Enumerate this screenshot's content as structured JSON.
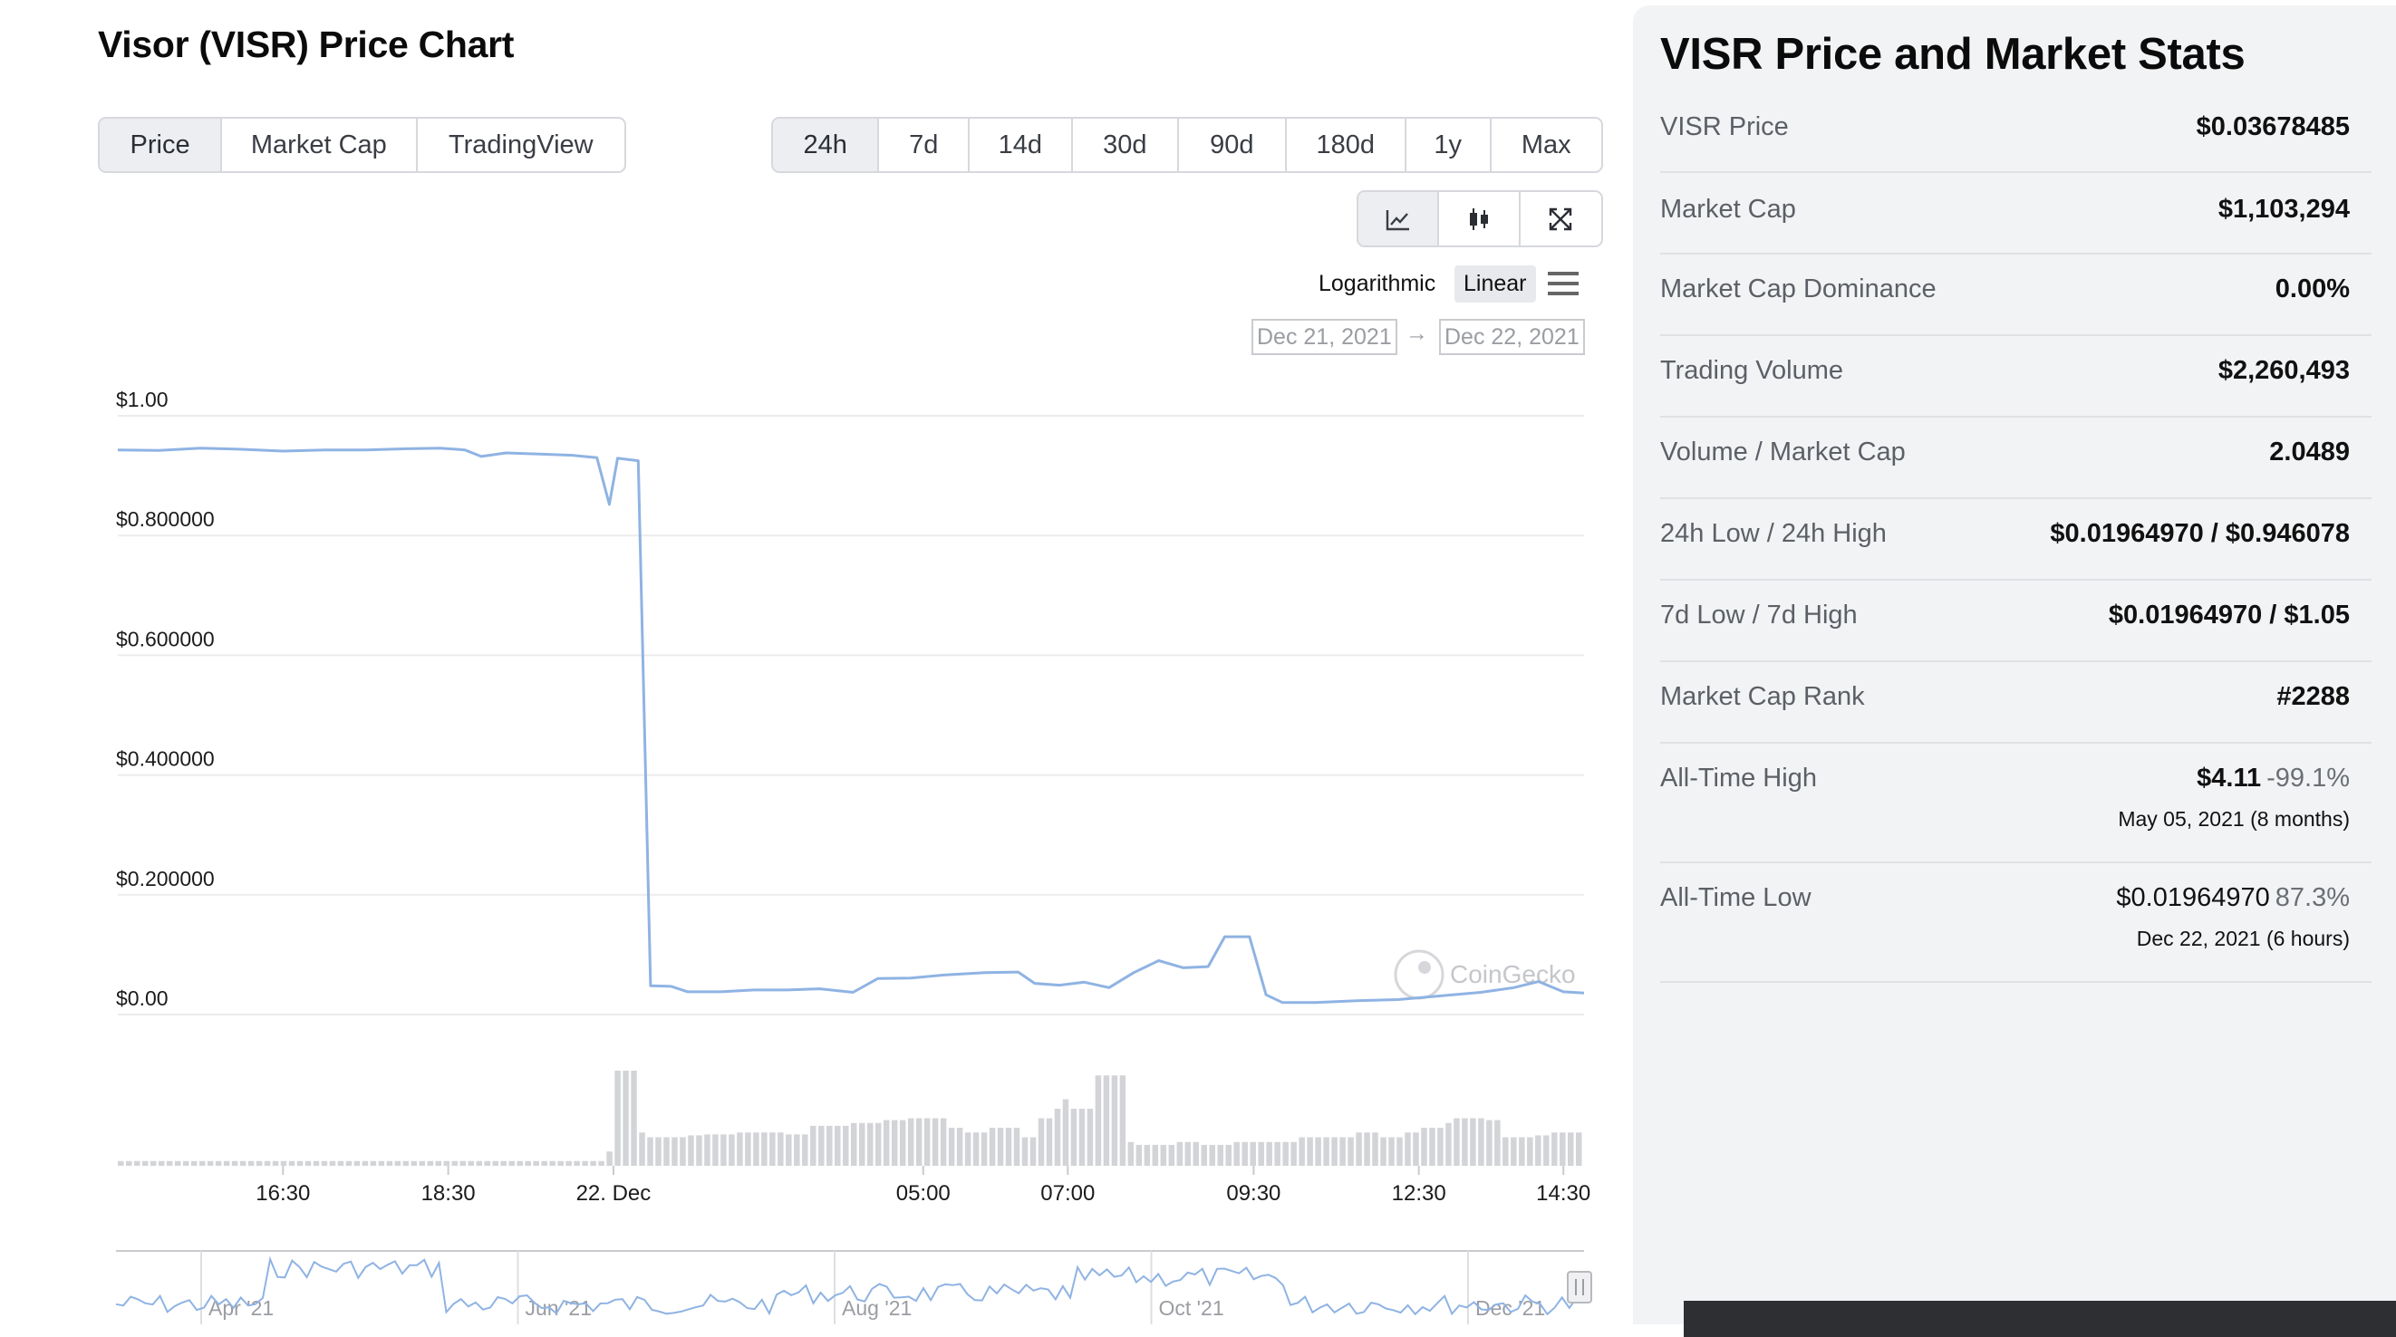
{
  "page_title": "Visor (VISR) Price Chart",
  "tabs": [
    {
      "label": "Price",
      "active": true
    },
    {
      "label": "Market Cap",
      "active": false
    },
    {
      "label": "TradingView",
      "active": false
    }
  ],
  "ranges": [
    {
      "label": "24h",
      "active": true
    },
    {
      "label": "7d",
      "active": false
    },
    {
      "label": "14d",
      "active": false
    },
    {
      "label": "30d",
      "active": false
    },
    {
      "label": "90d",
      "active": false
    },
    {
      "label": "180d",
      "active": false
    },
    {
      "label": "1y",
      "active": false
    },
    {
      "label": "Max",
      "active": false
    }
  ],
  "chart_type_icons": [
    "line-chart-icon",
    "candlestick-icon",
    "fullscreen-icon"
  ],
  "scale": {
    "log_label": "Logarithmic",
    "linear_label": "Linear",
    "active": "Linear"
  },
  "date_range": {
    "from": "Dec 21, 2021",
    "to": "Dec 22, 2021"
  },
  "watermark": "CoinGecko",
  "colors": {
    "line": "#8fb3e3",
    "volume": "#d3d4d7",
    "grid": "#ececee",
    "navigator_line": "#8fb3e3"
  },
  "chart_data": {
    "type": "line",
    "y_ticks": [
      "$1.00",
      "$0.800000",
      "$0.600000",
      "$0.400000",
      "$0.200000",
      "$0.00"
    ],
    "ylim": [
      0,
      1.0
    ],
    "x_ticks": [
      {
        "label": "16:30",
        "t": 2.5
      },
      {
        "label": "18:30",
        "t": 4.5
      },
      {
        "label": "22. Dec",
        "t": 6.5
      },
      {
        "label": "05:00",
        "t": 10.25
      },
      {
        "label": "07:00",
        "t": 12.0
      },
      {
        "label": "09:30",
        "t": 14.25
      },
      {
        "label": "12:30",
        "t": 16.25
      },
      {
        "label": "14:30",
        "t": 18.0
      }
    ],
    "xlim": [
      0.5,
      18.25
    ],
    "series": [
      {
        "values": [
          [
            0.5,
            0.943
          ],
          [
            1.0,
            0.942
          ],
          [
            1.5,
            0.946
          ],
          [
            2.0,
            0.944
          ],
          [
            2.5,
            0.941
          ],
          [
            3.0,
            0.943
          ],
          [
            3.5,
            0.943
          ],
          [
            4.0,
            0.945
          ],
          [
            4.4,
            0.946
          ],
          [
            4.7,
            0.943
          ],
          [
            4.9,
            0.932
          ],
          [
            5.2,
            0.938
          ],
          [
            5.6,
            0.936
          ],
          [
            6.0,
            0.934
          ],
          [
            6.3,
            0.93
          ],
          [
            6.45,
            0.852
          ],
          [
            6.55,
            0.929
          ],
          [
            6.8,
            0.925
          ],
          [
            6.95,
            0.048
          ],
          [
            7.2,
            0.047
          ],
          [
            7.4,
            0.038
          ],
          [
            7.8,
            0.038
          ],
          [
            8.2,
            0.041
          ],
          [
            8.6,
            0.041
          ],
          [
            9.0,
            0.043
          ],
          [
            9.4,
            0.037
          ],
          [
            9.7,
            0.06
          ],
          [
            10.1,
            0.061
          ],
          [
            10.5,
            0.066
          ],
          [
            11.0,
            0.07
          ],
          [
            11.4,
            0.071
          ],
          [
            11.6,
            0.052
          ],
          [
            11.9,
            0.049
          ],
          [
            12.2,
            0.054
          ],
          [
            12.5,
            0.045
          ],
          [
            12.8,
            0.07
          ],
          [
            13.1,
            0.09
          ],
          [
            13.4,
            0.078
          ],
          [
            13.7,
            0.08
          ],
          [
            13.9,
            0.13
          ],
          [
            14.2,
            0.13
          ],
          [
            14.4,
            0.033
          ],
          [
            14.6,
            0.02
          ],
          [
            15.0,
            0.02
          ],
          [
            15.5,
            0.023
          ],
          [
            16.0,
            0.025
          ],
          [
            16.5,
            0.031
          ],
          [
            17.0,
            0.037
          ],
          [
            17.4,
            0.045
          ],
          [
            17.7,
            0.055
          ],
          [
            18.0,
            0.038
          ],
          [
            18.25,
            0.036
          ]
        ]
      }
    ],
    "volume": [
      0.05,
      0.05,
      0.05,
      0.05,
      0.05,
      0.05,
      0.05,
      0.05,
      0.05,
      0.05,
      0.05,
      0.05,
      0.05,
      0.05,
      0.05,
      0.05,
      0.05,
      0.05,
      0.05,
      0.05,
      0.05,
      0.05,
      0.05,
      0.05,
      0.05,
      0.05,
      0.05,
      0.05,
      0.05,
      0.05,
      0.05,
      0.05,
      0.05,
      0.05,
      0.05,
      0.05,
      0.05,
      0.05,
      0.05,
      0.05,
      0.05,
      0.05,
      0.05,
      0.05,
      0.05,
      0.05,
      0.05,
      0.05,
      0.05,
      0.05,
      0.05,
      0.05,
      0.05,
      0.05,
      0.05,
      0.05,
      0.05,
      0.05,
      0.05,
      0.05,
      0.15,
      1.0,
      1.0,
      1.0,
      0.35,
      0.3,
      0.3,
      0.3,
      0.3,
      0.3,
      0.32,
      0.32,
      0.33,
      0.33,
      0.33,
      0.33,
      0.35,
      0.35,
      0.35,
      0.35,
      0.35,
      0.35,
      0.33,
      0.33,
      0.33,
      0.42,
      0.42,
      0.42,
      0.42,
      0.42,
      0.45,
      0.45,
      0.45,
      0.45,
      0.48,
      0.48,
      0.48,
      0.5,
      0.5,
      0.5,
      0.5,
      0.5,
      0.4,
      0.4,
      0.35,
      0.35,
      0.35,
      0.4,
      0.4,
      0.4,
      0.4,
      0.3,
      0.3,
      0.5,
      0.5,
      0.6,
      0.7,
      0.6,
      0.6,
      0.6,
      0.95,
      0.95,
      0.95,
      0.95,
      0.25,
      0.22,
      0.22,
      0.22,
      0.22,
      0.22,
      0.25,
      0.25,
      0.25,
      0.22,
      0.22,
      0.22,
      0.22,
      0.25,
      0.25,
      0.25,
      0.25,
      0.25,
      0.25,
      0.25,
      0.25,
      0.3,
      0.3,
      0.3,
      0.3,
      0.3,
      0.3,
      0.3,
      0.35,
      0.35,
      0.35,
      0.3,
      0.3,
      0.3,
      0.35,
      0.35,
      0.4,
      0.4,
      0.4,
      0.45,
      0.5,
      0.5,
      0.5,
      0.5,
      0.48,
      0.48,
      0.3,
      0.3,
      0.3,
      0.3,
      0.32,
      0.32,
      0.35,
      0.35,
      0.35,
      0.35
    ],
    "navigator": {
      "x_labels": [
        "Apr '21",
        "Jun '21",
        "Aug '21",
        "Oct '21",
        "Dec '21"
      ]
    }
  },
  "stats": {
    "title": "VISR Price and Market Stats",
    "rows": [
      {
        "label": "VISR Price",
        "value": "$0.03678485"
      },
      {
        "label": "Market Cap",
        "value": "$1,103,294"
      },
      {
        "label": "Market Cap Dominance",
        "value": "0.00%"
      },
      {
        "label": "Trading Volume",
        "value": "$2,260,493"
      },
      {
        "label": "Volume / Market Cap",
        "value": "2.0489"
      },
      {
        "label": "24h Low / 24h High",
        "value": "$0.01964970 / $0.946078"
      },
      {
        "label": "7d Low / 7d High",
        "value": "$0.01964970 / $1.05"
      },
      {
        "label": "Market Cap Rank",
        "value": "#2288"
      }
    ],
    "ath": {
      "label": "All-Time High",
      "value": "$4.11",
      "pct": "-99.1%",
      "date": "May 05, 2021 (8 months)"
    },
    "atl": {
      "label": "All-Time Low",
      "value": "$0.01964970",
      "pct": "87.3%",
      "date": "Dec 22, 2021 (6 hours)"
    }
  }
}
